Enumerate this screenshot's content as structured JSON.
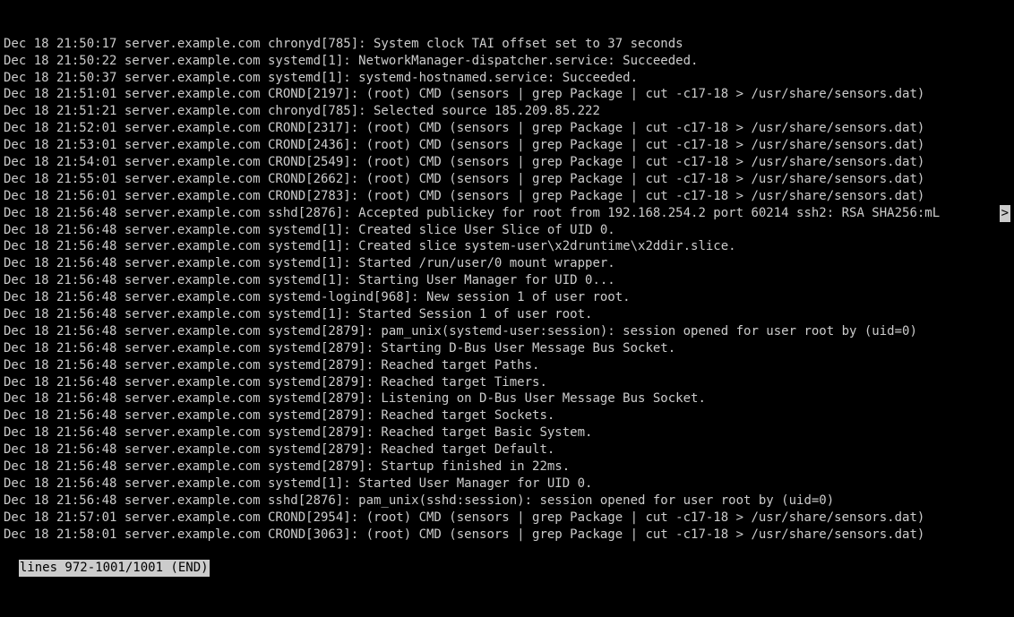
{
  "log": {
    "lines": [
      "Dec 18 21:50:17 server.example.com chronyd[785]: System clock TAI offset set to 37 seconds",
      "Dec 18 21:50:22 server.example.com systemd[1]: NetworkManager-dispatcher.service: Succeeded.",
      "Dec 18 21:50:37 server.example.com systemd[1]: systemd-hostnamed.service: Succeeded.",
      "Dec 18 21:51:01 server.example.com CROND[2197]: (root) CMD (sensors | grep Package | cut -c17-18 > /usr/share/sensors.dat)",
      "Dec 18 21:51:21 server.example.com chronyd[785]: Selected source 185.209.85.222",
      "Dec 18 21:52:01 server.example.com CROND[2317]: (root) CMD (sensors | grep Package | cut -c17-18 > /usr/share/sensors.dat)",
      "Dec 18 21:53:01 server.example.com CROND[2436]: (root) CMD (sensors | grep Package | cut -c17-18 > /usr/share/sensors.dat)",
      "Dec 18 21:54:01 server.example.com CROND[2549]: (root) CMD (sensors | grep Package | cut -c17-18 > /usr/share/sensors.dat)",
      "Dec 18 21:55:01 server.example.com CROND[2662]: (root) CMD (sensors | grep Package | cut -c17-18 > /usr/share/sensors.dat)",
      "Dec 18 21:56:01 server.example.com CROND[2783]: (root) CMD (sensors | grep Package | cut -c17-18 > /usr/share/sensors.dat)",
      "Dec 18 21:56:48 server.example.com sshd[2876]: Accepted publickey for root from 192.168.254.2 port 60214 ssh2: RSA SHA256:mL",
      "Dec 18 21:56:48 server.example.com systemd[1]: Created slice User Slice of UID 0.",
      "Dec 18 21:56:48 server.example.com systemd[1]: Created slice system-user\\x2druntime\\x2ddir.slice.",
      "Dec 18 21:56:48 server.example.com systemd[1]: Started /run/user/0 mount wrapper.",
      "Dec 18 21:56:48 server.example.com systemd[1]: Starting User Manager for UID 0...",
      "Dec 18 21:56:48 server.example.com systemd-logind[968]: New session 1 of user root.",
      "Dec 18 21:56:48 server.example.com systemd[1]: Started Session 1 of user root.",
      "Dec 18 21:56:48 server.example.com systemd[2879]: pam_unix(systemd-user:session): session opened for user root by (uid=0)",
      "Dec 18 21:56:48 server.example.com systemd[2879]: Starting D-Bus User Message Bus Socket.",
      "Dec 18 21:56:48 server.example.com systemd[2879]: Reached target Paths.",
      "Dec 18 21:56:48 server.example.com systemd[2879]: Reached target Timers.",
      "Dec 18 21:56:48 server.example.com systemd[2879]: Listening on D-Bus User Message Bus Socket.",
      "Dec 18 21:56:48 server.example.com systemd[2879]: Reached target Sockets.",
      "Dec 18 21:56:48 server.example.com systemd[2879]: Reached target Basic System.",
      "Dec 18 21:56:48 server.example.com systemd[2879]: Reached target Default.",
      "Dec 18 21:56:48 server.example.com systemd[2879]: Startup finished in 22ms.",
      "Dec 18 21:56:48 server.example.com systemd[1]: Started User Manager for UID 0.",
      "Dec 18 21:56:48 server.example.com sshd[2876]: pam_unix(sshd:session): session opened for user root by (uid=0)",
      "Dec 18 21:57:01 server.example.com CROND[2954]: (root) CMD (sensors | grep Package | cut -c17-18 > /usr/share/sensors.dat)",
      "Dec 18 21:58:01 server.example.com CROND[3063]: (root) CMD (sensors | grep Package | cut -c17-18 > /usr/share/sensors.dat)"
    ],
    "truncated_line_index": 10,
    "truncation_marker": ">"
  },
  "pager": {
    "status": "lines 972-1001/1001 (END)"
  }
}
